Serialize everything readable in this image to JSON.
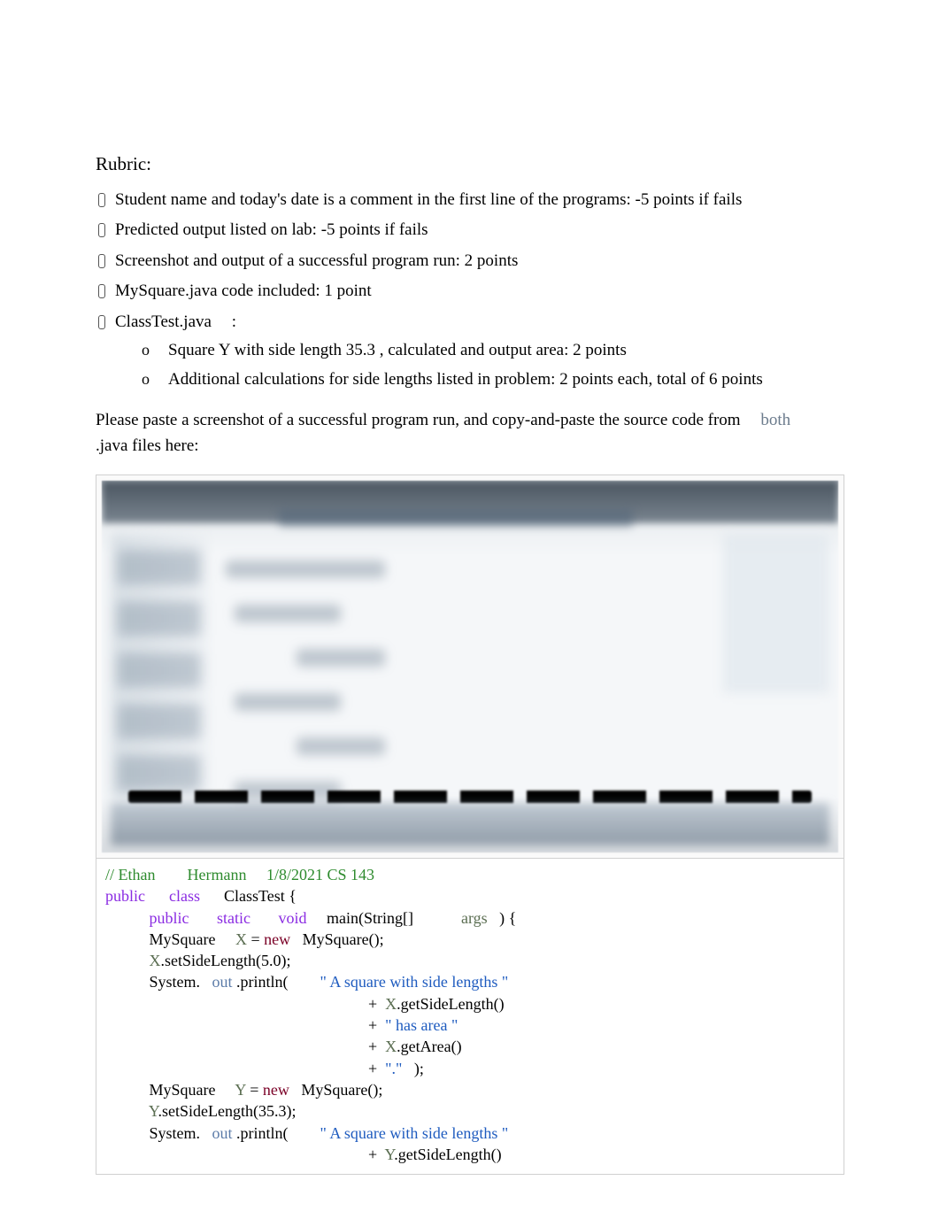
{
  "rubric": {
    "title": "Rubric:",
    "items": [
      "Student name and today's date is a comment in the first line of the programs: -5 points if fails",
      "Predicted output listed on lab: -5 points if fails",
      "Screenshot and output of a successful program run: 2 points",
      "MySquare.java code included: 1 point"
    ],
    "classtest_label_a": "ClassTest.java",
    "classtest_label_b": ":",
    "sub_a_pre": "Square ",
    "sub_a_var": "Y ",
    "sub_a_mid": "with side length ",
    "sub_a_num": "35.3",
    "sub_a_post": "   , calculated and output area: 2 points",
    "sub_b": "Additional calculations for side lengths listed in problem: 2 points each, total of 6 points"
  },
  "paragraph": {
    "pre": "Please paste a screenshot of a successful program run, and copy-and-paste the source code from",
    "both": "both",
    "java": ".java",
    "post": "  files here:"
  },
  "code": {
    "comment_a": "// Ethan",
    "comment_b": "Hermann",
    "comment_c": "1/8/2021 CS 143",
    "kw_public": "public",
    "kw_class": "class",
    "cls_name": "ClassTest {",
    "kw_static": "static",
    "kw_void": "void",
    "main_sig": "main(String[]",
    "args": "args",
    "paren_brace": ") {",
    "type_mysq": "MySquare",
    "var_x": "X",
    "eq": " = ",
    "kw_new": "new",
    "ctor": "MySquare();",
    "x_set": ".setSideLength(5.0);",
    "sys": "System.",
    "out": "out",
    "println": ".println(",
    "str1": "\" A square with side lengths \"",
    "plus": "+ ",
    "x_get_side": ".getSideLength()",
    "str_has": "\" has area \"",
    "x_get_area": ".getArea()",
    "str_dot": "\".\"",
    "close_p": ");",
    "var_y": "Y",
    "y_set": ".setSideLength(35.3);",
    "y_get_side": ".getSideLength()"
  }
}
